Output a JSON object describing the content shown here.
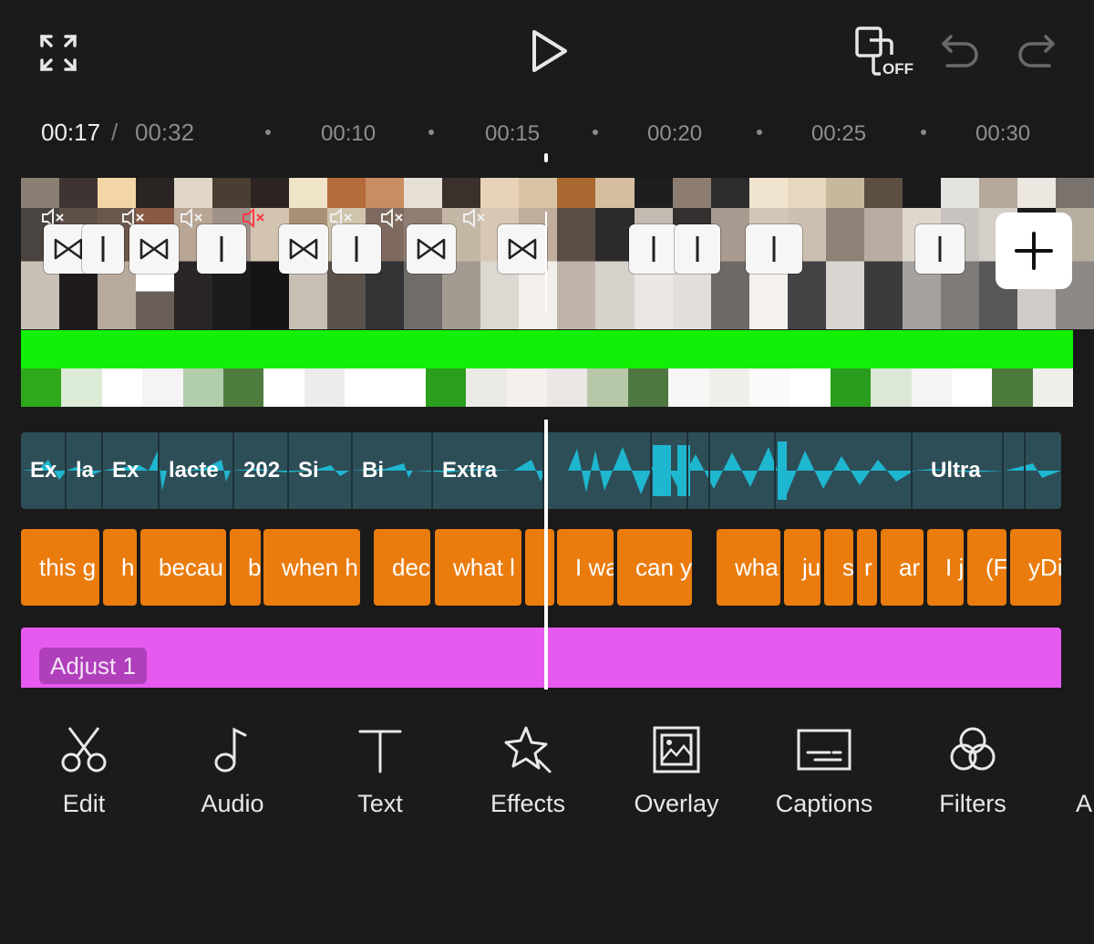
{
  "topbar": {
    "preview_off_label": "OFF"
  },
  "ruler": {
    "current_time": "00:17",
    "separator": "/",
    "total_time": "00:32",
    "ticks": [
      "00:10",
      "00:15",
      "00:20",
      "00:25",
      "00:30"
    ]
  },
  "tracks": {
    "audio_labels": [
      "Ex",
      "la",
      "Ex",
      "lacte",
      "202",
      "Si",
      "Bi",
      "Extra",
      "Ultra"
    ],
    "captions": [
      "this g",
      "h",
      "becau",
      "b",
      "when h",
      "dec",
      "what l",
      "I wa",
      "can y",
      "wha",
      "ju",
      "s",
      "r",
      "ar",
      "I ju",
      "(F",
      "yDi"
    ],
    "adjust_label": "Adjust 1"
  },
  "colors": {
    "green_track": "#13f007",
    "audio_track": "#2d4e57",
    "caption_track": "#ea7c0e",
    "adjust_track": "#e75af0",
    "waveform": "#1fb6cf"
  },
  "toolbar": {
    "edit": "Edit",
    "audio": "Audio",
    "text": "Text",
    "effects": "Effects",
    "overlay": "Overlay",
    "captions": "Captions",
    "filters": "Filters",
    "more": "A"
  }
}
